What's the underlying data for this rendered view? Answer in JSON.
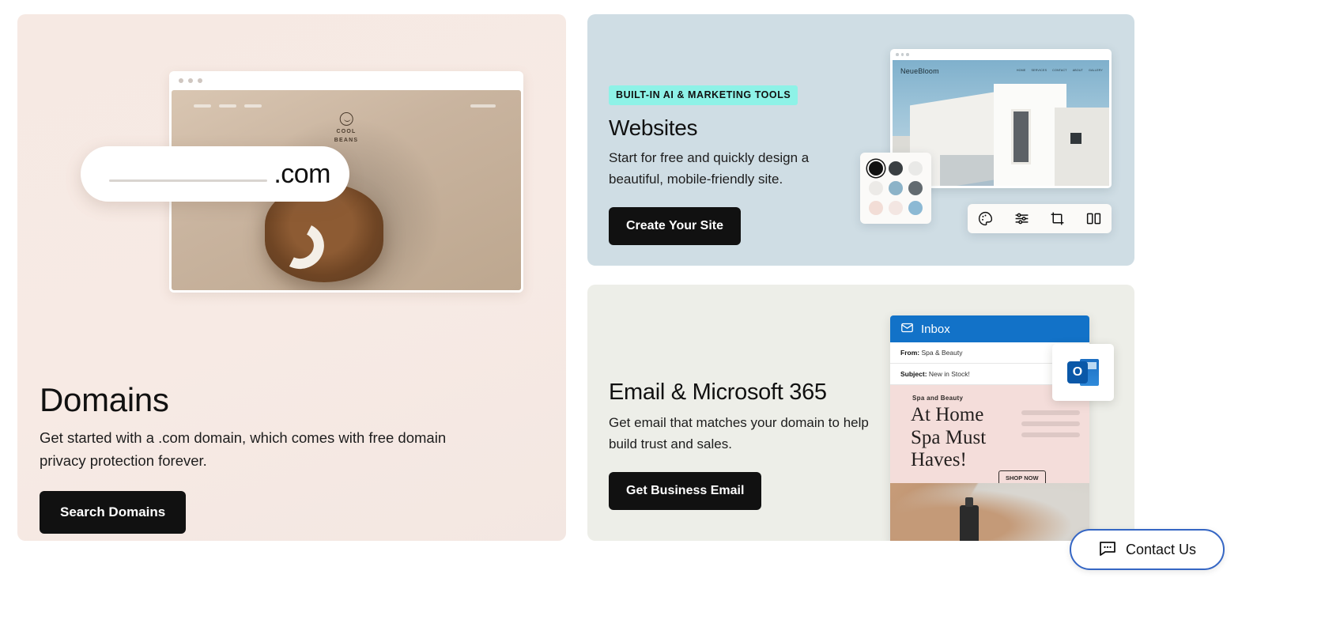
{
  "colors": {
    "domains_card_bg": "#f6e9e3",
    "websites_card_bg": "#cfdde4",
    "email_card_bg": "#edeee8",
    "badge_bg": "#8ef2e7",
    "cta_bg": "#111111",
    "inbox_header_blue": "#1272c8",
    "contact_border_blue": "#3566c4"
  },
  "domains": {
    "title": "Domains",
    "description": "Get started with a .com domain, which comes with free domain privacy protection forever.",
    "cta_label": "Search Domains",
    "art": {
      "search_field_value": "",
      "tld_text": ".com",
      "site_logo_line1": "COOL",
      "site_logo_line2": "BEANS"
    }
  },
  "websites": {
    "badge": "BUILT-IN AI & MARKETING TOOLS",
    "title": "Websites",
    "description": "Start for free and quickly design a beautiful, mobile-friendly site.",
    "cta_label": "Create Your Site",
    "preview": {
      "site_name": "NeueBloom",
      "nav": [
        "HOME",
        "SERVICES",
        "CONTACT",
        "ABOUT",
        "GALLERY"
      ]
    },
    "swatches": [
      "#111111",
      "#3a3f42",
      "#e9e9e7",
      "#eceae7",
      "#8cb3c8",
      "#636b70",
      "#f2ddd6",
      "#f3e6e2",
      "#8cb9d4"
    ],
    "selected_swatch_index": 0,
    "toolbar_icons": [
      "palette-icon",
      "sliders-icon",
      "crop-icon",
      "layout-icon"
    ]
  },
  "email": {
    "title": "Email & Microsoft 365",
    "description": "Get email that matches your domain to help build trust and sales.",
    "cta_label": "Get Business Email",
    "inbox": {
      "header": "Inbox",
      "from_label": "From:",
      "from_value": "Spa & Beauty",
      "subject_label": "Subject:",
      "subject_value": "New in Stock!",
      "promo_kicker": "Spa and Beauty",
      "promo_heading": "At Home Spa Must Haves!",
      "promo_cta": "SHOP NOW"
    },
    "outlook_badge": "outlook-icon"
  },
  "contact": {
    "label": "Contact Us",
    "icon": "chat-bubble-icon"
  }
}
